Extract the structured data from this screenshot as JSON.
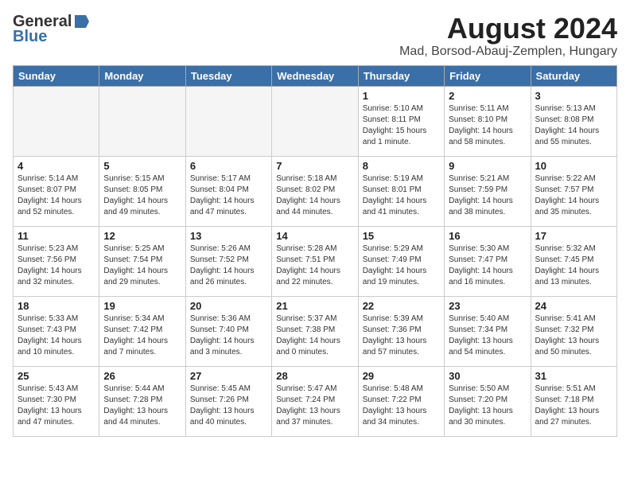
{
  "logo": {
    "general": "General",
    "blue": "Blue"
  },
  "title": "August 2024",
  "subtitle": "Mad, Borsod-Abauj-Zemplen, Hungary",
  "weekdays": [
    "Sunday",
    "Monday",
    "Tuesday",
    "Wednesday",
    "Thursday",
    "Friday",
    "Saturday"
  ],
  "weeks": [
    [
      {
        "day": "",
        "info": ""
      },
      {
        "day": "",
        "info": ""
      },
      {
        "day": "",
        "info": ""
      },
      {
        "day": "",
        "info": ""
      },
      {
        "day": "1",
        "info": "Sunrise: 5:10 AM\nSunset: 8:11 PM\nDaylight: 15 hours and 1 minute."
      },
      {
        "day": "2",
        "info": "Sunrise: 5:11 AM\nSunset: 8:10 PM\nDaylight: 14 hours and 58 minutes."
      },
      {
        "day": "3",
        "info": "Sunrise: 5:13 AM\nSunset: 8:08 PM\nDaylight: 14 hours and 55 minutes."
      }
    ],
    [
      {
        "day": "4",
        "info": "Sunrise: 5:14 AM\nSunset: 8:07 PM\nDaylight: 14 hours and 52 minutes."
      },
      {
        "day": "5",
        "info": "Sunrise: 5:15 AM\nSunset: 8:05 PM\nDaylight: 14 hours and 49 minutes."
      },
      {
        "day": "6",
        "info": "Sunrise: 5:17 AM\nSunset: 8:04 PM\nDaylight: 14 hours and 47 minutes."
      },
      {
        "day": "7",
        "info": "Sunrise: 5:18 AM\nSunset: 8:02 PM\nDaylight: 14 hours and 44 minutes."
      },
      {
        "day": "8",
        "info": "Sunrise: 5:19 AM\nSunset: 8:01 PM\nDaylight: 14 hours and 41 minutes."
      },
      {
        "day": "9",
        "info": "Sunrise: 5:21 AM\nSunset: 7:59 PM\nDaylight: 14 hours and 38 minutes."
      },
      {
        "day": "10",
        "info": "Sunrise: 5:22 AM\nSunset: 7:57 PM\nDaylight: 14 hours and 35 minutes."
      }
    ],
    [
      {
        "day": "11",
        "info": "Sunrise: 5:23 AM\nSunset: 7:56 PM\nDaylight: 14 hours and 32 minutes."
      },
      {
        "day": "12",
        "info": "Sunrise: 5:25 AM\nSunset: 7:54 PM\nDaylight: 14 hours and 29 minutes."
      },
      {
        "day": "13",
        "info": "Sunrise: 5:26 AM\nSunset: 7:52 PM\nDaylight: 14 hours and 26 minutes."
      },
      {
        "day": "14",
        "info": "Sunrise: 5:28 AM\nSunset: 7:51 PM\nDaylight: 14 hours and 22 minutes."
      },
      {
        "day": "15",
        "info": "Sunrise: 5:29 AM\nSunset: 7:49 PM\nDaylight: 14 hours and 19 minutes."
      },
      {
        "day": "16",
        "info": "Sunrise: 5:30 AM\nSunset: 7:47 PM\nDaylight: 14 hours and 16 minutes."
      },
      {
        "day": "17",
        "info": "Sunrise: 5:32 AM\nSunset: 7:45 PM\nDaylight: 14 hours and 13 minutes."
      }
    ],
    [
      {
        "day": "18",
        "info": "Sunrise: 5:33 AM\nSunset: 7:43 PM\nDaylight: 14 hours and 10 minutes."
      },
      {
        "day": "19",
        "info": "Sunrise: 5:34 AM\nSunset: 7:42 PM\nDaylight: 14 hours and 7 minutes."
      },
      {
        "day": "20",
        "info": "Sunrise: 5:36 AM\nSunset: 7:40 PM\nDaylight: 14 hours and 3 minutes."
      },
      {
        "day": "21",
        "info": "Sunrise: 5:37 AM\nSunset: 7:38 PM\nDaylight: 14 hours and 0 minutes."
      },
      {
        "day": "22",
        "info": "Sunrise: 5:39 AM\nSunset: 7:36 PM\nDaylight: 13 hours and 57 minutes."
      },
      {
        "day": "23",
        "info": "Sunrise: 5:40 AM\nSunset: 7:34 PM\nDaylight: 13 hours and 54 minutes."
      },
      {
        "day": "24",
        "info": "Sunrise: 5:41 AM\nSunset: 7:32 PM\nDaylight: 13 hours and 50 minutes."
      }
    ],
    [
      {
        "day": "25",
        "info": "Sunrise: 5:43 AM\nSunset: 7:30 PM\nDaylight: 13 hours and 47 minutes."
      },
      {
        "day": "26",
        "info": "Sunrise: 5:44 AM\nSunset: 7:28 PM\nDaylight: 13 hours and 44 minutes."
      },
      {
        "day": "27",
        "info": "Sunrise: 5:45 AM\nSunset: 7:26 PM\nDaylight: 13 hours and 40 minutes."
      },
      {
        "day": "28",
        "info": "Sunrise: 5:47 AM\nSunset: 7:24 PM\nDaylight: 13 hours and 37 minutes."
      },
      {
        "day": "29",
        "info": "Sunrise: 5:48 AM\nSunset: 7:22 PM\nDaylight: 13 hours and 34 minutes."
      },
      {
        "day": "30",
        "info": "Sunrise: 5:50 AM\nSunset: 7:20 PM\nDaylight: 13 hours and 30 minutes."
      },
      {
        "day": "31",
        "info": "Sunrise: 5:51 AM\nSunset: 7:18 PM\nDaylight: 13 hours and 27 minutes."
      }
    ]
  ]
}
